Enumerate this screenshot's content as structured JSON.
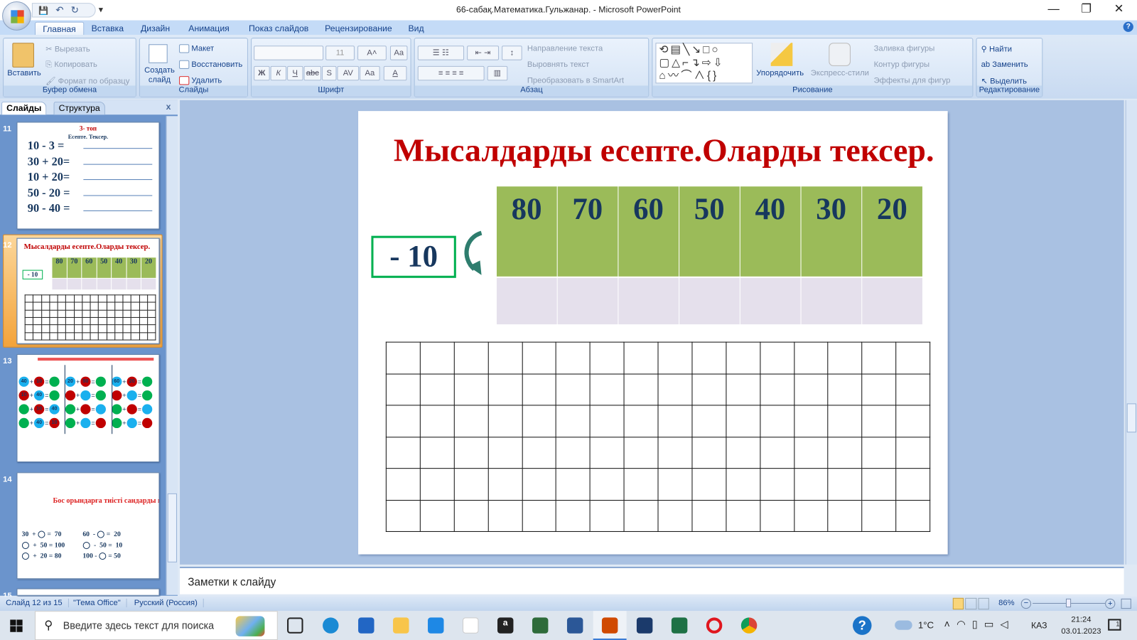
{
  "window": {
    "title": "66-сабақ.Математика.Гульжанар. - Microsoft PowerPoint",
    "minimize": "—",
    "restore": "❐",
    "close": "✕"
  },
  "qat": {
    "save": "💾",
    "undo": "↶",
    "redo": "↻",
    "customize": "▾"
  },
  "tabs": [
    {
      "label": "Главная",
      "active": true
    },
    {
      "label": "Вставка"
    },
    {
      "label": "Дизайн"
    },
    {
      "label": "Анимация"
    },
    {
      "label": "Показ слайдов"
    },
    {
      "label": "Рецензирование"
    },
    {
      "label": "Вид"
    }
  ],
  "help": "?",
  "ribbon": {
    "clipboard": {
      "label": "Буфер обмена",
      "paste": "Вставить",
      "cut": "Вырезать",
      "copy": "Копировать",
      "format_painter": "Формат по образцу"
    },
    "slides": {
      "label": "Слайды",
      "new_slide": "Создать слайд",
      "layout": "Макет",
      "reset": "Восстановить",
      "delete": "Удалить"
    },
    "font": {
      "label": "Шрифт",
      "font_name": "",
      "font_size": "11",
      "grow": "A˄",
      "shrink": "A˅",
      "clear": "Aa",
      "bold": "Ж",
      "italic": "К",
      "underline": "Ч",
      "strike": "abc",
      "shadow": "S",
      "spacing": "AV",
      "case": "Aa",
      "color": "A"
    },
    "paragraph": {
      "label": "Абзац",
      "text_direction": "Направление текста",
      "align_text": "Выровнять текст",
      "smartart": "Преобразовать в SmartArt"
    },
    "drawing": {
      "label": "Рисование",
      "arrange": "Упорядочить",
      "quick_styles": "Экспресс-стили",
      "fill": "Заливка фигуры",
      "outline": "Контур фигуры",
      "effects": "Эффекты для фигур"
    },
    "editing": {
      "label": "Редактирование",
      "find": "Найти",
      "replace": "Заменить",
      "select": "Выделить"
    }
  },
  "pane": {
    "tab_slides": "Слайды",
    "tab_outline": "Структура",
    "close": "x",
    "thumb11": {
      "num": "11",
      "title": "3- топ",
      "subtitle": "Есепте. Тексер.",
      "lines": [
        "10 - 3 =",
        "30 + 20=",
        "10 + 20=",
        "50 - 20 =",
        "90 - 40 ="
      ]
    },
    "thumb12": {
      "num": "12",
      "title": "Мысалдарды  есепте.Оларды тексер.",
      "box": "- 10"
    },
    "thumb13": {
      "num": "13",
      "rows": [
        [
          "40",
          "10",
          "",
          "20",
          "50",
          "",
          "60",
          "20",
          ""
        ],
        [
          "10",
          "40",
          "",
          "",
          "",
          "",
          "",
          "",
          ""
        ],
        [
          "",
          "10",
          "40",
          "",
          "",
          "",
          "",
          "",
          ""
        ],
        [
          "",
          "40",
          "10",
          "",
          "",
          "",
          "",
          "",
          ""
        ]
      ]
    },
    "thumb14": {
      "num": "14",
      "title": "Бос орындарға тиісті сандарды қой.",
      "left": [
        "30  + ◯ =  70",
        "◯  +  50 = 100",
        "◯  +  20 = 80"
      ],
      "right": [
        "60  - ◯ =  20",
        "◯  -  50 =  10",
        "100 - ◯ = 50"
      ]
    },
    "thumb15": {
      "num": "15"
    }
  },
  "slide": {
    "title": "Мысалдарды  есепте.Оларды тексер.",
    "operator": "- 10",
    "numbers": [
      "80",
      "70",
      "60",
      "50",
      "40",
      "30",
      "20"
    ],
    "grid_rows": 6,
    "grid_cols": 16
  },
  "notes": {
    "placeholder": "Заметки к слайду"
  },
  "status": {
    "slide": "Слайд 12 из 15",
    "theme": "\"Тема Office\"",
    "language": "Русский (Россия)",
    "zoom": "86%",
    "zoom_value": 86
  },
  "taskbar": {
    "search_placeholder": "Введите здесь текст для поиска",
    "weather": "1°C",
    "lang": "КАЗ",
    "time": "21:24",
    "date": "03.01.2023",
    "notif": "1"
  },
  "colors": {
    "title_red": "#c00000",
    "cell_green": "#9bbb59",
    "box_green": "#00b050",
    "answer_row": "#e5e0ec",
    "number_navy": "#17375e"
  }
}
